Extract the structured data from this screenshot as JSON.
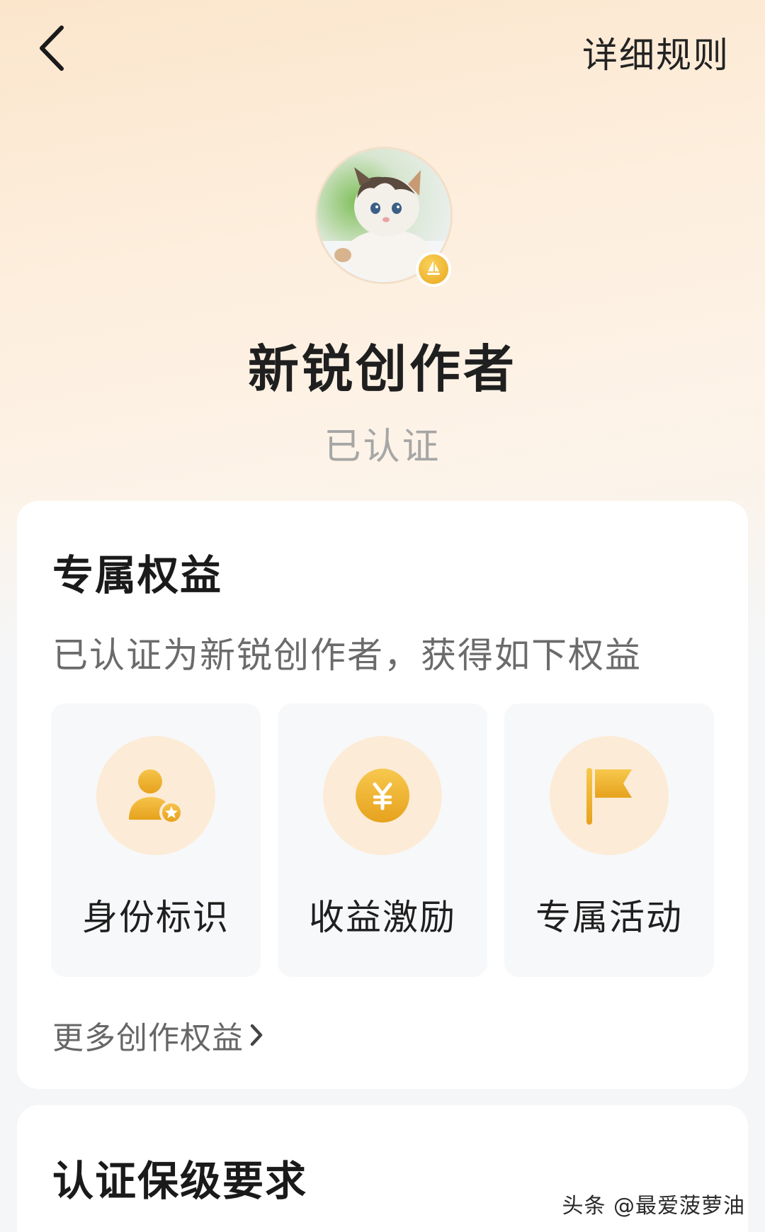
{
  "header": {
    "back_icon": "chevron-left-icon",
    "rules_label": "详细规则"
  },
  "profile": {
    "avatar_alt": "kitten avatar",
    "badge_icon": "sailboat-badge-icon",
    "level_title": "新锐创作者",
    "status": "已认证"
  },
  "benefits": {
    "title": "专属权益",
    "description": "已认证为新锐创作者，获得如下权益",
    "items": [
      {
        "label": "身份标识",
        "icon": "identity-badge-icon"
      },
      {
        "label": "收益激励",
        "icon": "yuan-coin-icon"
      },
      {
        "label": "专属活动",
        "icon": "flag-icon"
      }
    ],
    "more_label": "更多创作权益"
  },
  "requirements": {
    "title": "认证保级要求"
  },
  "watermark": "头条 @最爱菠萝油",
  "colors": {
    "accent_gold": "#e9a81b",
    "icon_bg": "#fcebd6",
    "text_primary": "#1a1a1a",
    "text_secondary": "#6b6b6b",
    "text_muted": "#a6a6a6"
  }
}
